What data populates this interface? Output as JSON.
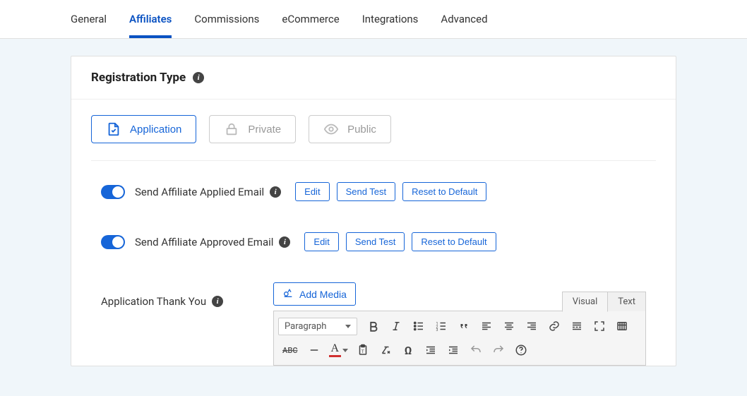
{
  "tabs": {
    "general": "General",
    "affiliates": "Affiliates",
    "commissions": "Commissions",
    "ecommerce": "eCommerce",
    "integrations": "Integrations",
    "advanced": "Advanced"
  },
  "panel": {
    "title": "Registration Type"
  },
  "regTypes": {
    "application": "Application",
    "private": "Private",
    "public": "Public"
  },
  "email1": {
    "label": "Send Affiliate Applied Email",
    "edit": "Edit",
    "sendTest": "Send Test",
    "reset": "Reset to Default"
  },
  "email2": {
    "label": "Send Affiliate Approved Email",
    "edit": "Edit",
    "sendTest": "Send Test",
    "reset": "Reset to Default"
  },
  "editor": {
    "label": "Application Thank You",
    "addMedia": "Add Media",
    "visual": "Visual",
    "text": "Text",
    "format": "Paragraph"
  }
}
